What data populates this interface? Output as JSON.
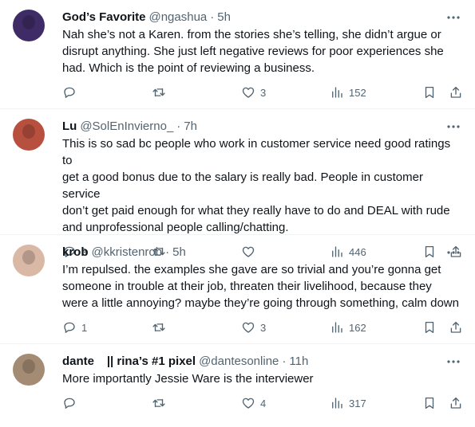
{
  "tweets": [
    {
      "name": "God’s Favorite",
      "handle": "@ngashua",
      "time": "5h",
      "text": "Nah she’s not a Karen. from the stories she’s telling, she didn’t argue or\ndisrupt anything. She just left negative reviews for poor experiences she\nhad. Which is the point of reviewing a business.",
      "replies": "",
      "retweets": "",
      "likes": "3",
      "views": "152",
      "avatar_color": "#3f2b66"
    },
    {
      "name": "Lu",
      "handle": "@SolEnInvierno_",
      "time": "7h",
      "text": "This is so sad bc people who work in customer service need good ratings to\nget a good bonus due to the salary is really bad. People in customer service\ndon’t get paid enough for what they really have to do and DEAL with rude\nand unprofessional people calling/chatting.",
      "replies": "3",
      "retweets": "",
      "likes": "",
      "views": "446",
      "avatar_color": "#b8503f"
    },
    {
      "name": "krob",
      "handle": "@kkristenrob",
      "time": "5h",
      "text": "I’m repulsed. the examples she gave are so trivial and you’re gonna get\nsomeone in trouble at their job, threaten their livelihood, because they\nwere a little annoying? maybe they’re going through something, calm down",
      "replies": "1",
      "retweets": "",
      "likes": "3",
      "views": "162",
      "avatar_color": "#d9b8a6"
    },
    {
      "name": "dante   || rina’s #1 pixel",
      "handle": "@dantesonline",
      "time": "11h",
      "text": "More importantly Jessie Ware is the interviewer",
      "replies": "",
      "retweets": "",
      "likes": "4",
      "views": "317",
      "avatar_color": "#a48c74"
    }
  ],
  "icons": {
    "more": "more-icon",
    "reply": "reply-icon",
    "retweet": "retweet-icon",
    "like": "heart-icon",
    "views": "views-icon",
    "bookmark": "bookmark-icon",
    "share": "share-icon"
  },
  "colors": {
    "text": "#0f1419",
    "secondary": "#536471",
    "divider": "#eff3f4"
  }
}
